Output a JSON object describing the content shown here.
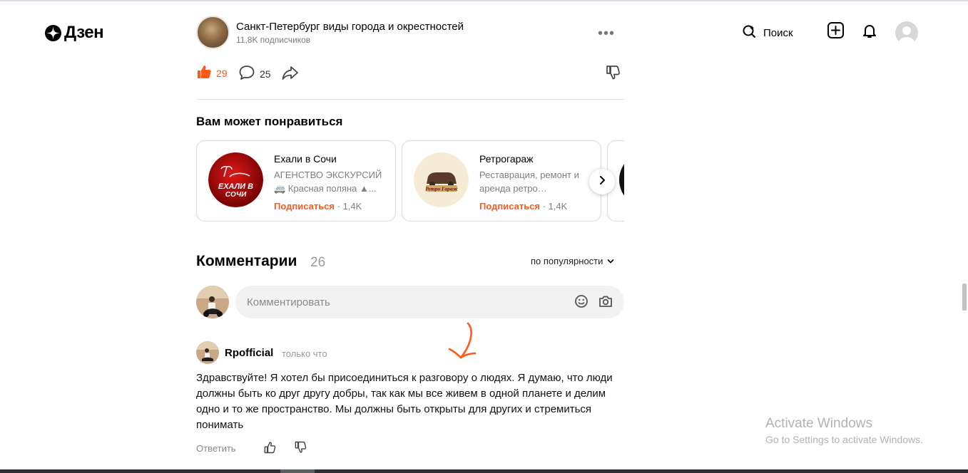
{
  "header": {
    "logo_text": "Дзен",
    "search_label": "Поиск"
  },
  "channel": {
    "name": "Санкт-Петербург виды города и окрестностей",
    "subscribers": "11,8K подписчиков",
    "more": "•••"
  },
  "actions": {
    "likes": "29",
    "comments": "25"
  },
  "recommend": {
    "title": "Вам может понравиться",
    "cards": [
      {
        "name": "Ехали в Сочи",
        "desc_line1": "АГЕНСТВО ЭКСКУРСИЙ",
        "desc_line2": "🚐 Красная поляна ▲...",
        "subscribe": "Подписаться",
        "count": " · 1,4K",
        "avatar_text_1": "ЕХАЛИ В",
        "avatar_text_2": "СОЧИ"
      },
      {
        "name": "Ретрогараж",
        "desc_line1": "Реставрация, ремонт и",
        "desc_line2": "аренда ретро…",
        "subscribe": "Подписаться",
        "count": " · 1,4K",
        "avatar_text_1": "Ретро Гараж"
      }
    ]
  },
  "comments": {
    "title": "Комментарии",
    "count": "26",
    "sort_label": "по популярности",
    "input_placeholder": "Комментировать",
    "items": [
      {
        "author": "Rpofficial",
        "time": "только что",
        "text": "Здравствуйте! Я хотел бы присоединиться к разговору о людях. Я думаю, что люди должны быть ко друг другу добры, так как мы все живем в одной планете и делим одно и то же пространство. Мы должны быть открыты для других и стремиться понимать",
        "reply_label": "Ответить"
      }
    ]
  },
  "windows_watermark": {
    "line1": "Activate Windows",
    "line2": "Go to Settings to activate Windows."
  },
  "colors": {
    "accent": "#ff5a19",
    "muted": "#808080"
  }
}
